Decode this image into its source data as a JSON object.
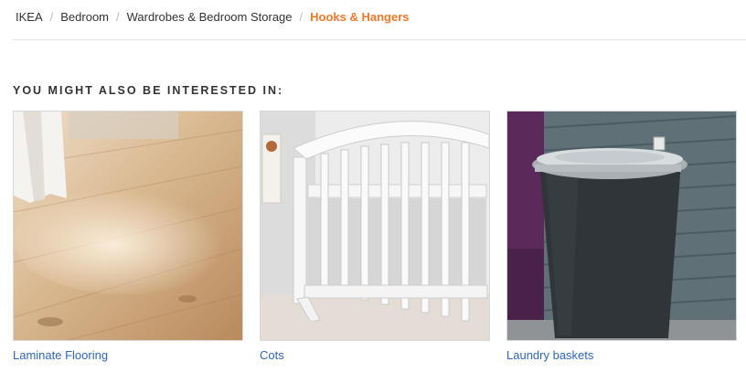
{
  "breadcrumb": {
    "items": [
      "IKEA",
      "Bedroom",
      "Wardrobes & Bedroom Storage"
    ],
    "separator": "/",
    "current": "Hooks & Hangers"
  },
  "section": {
    "title": "YOU MIGHT ALSO BE INTERESTED IN:"
  },
  "products": [
    {
      "label": "Laminate Flooring",
      "image": "laminate-flooring-image"
    },
    {
      "label": "Cots",
      "image": "cot-image"
    },
    {
      "label": "Laundry baskets",
      "image": "laundry-basket-image"
    }
  ],
  "colors": {
    "accent": "#f07a2a",
    "link": "#2f66b3",
    "divider": "#e6e6e6"
  }
}
